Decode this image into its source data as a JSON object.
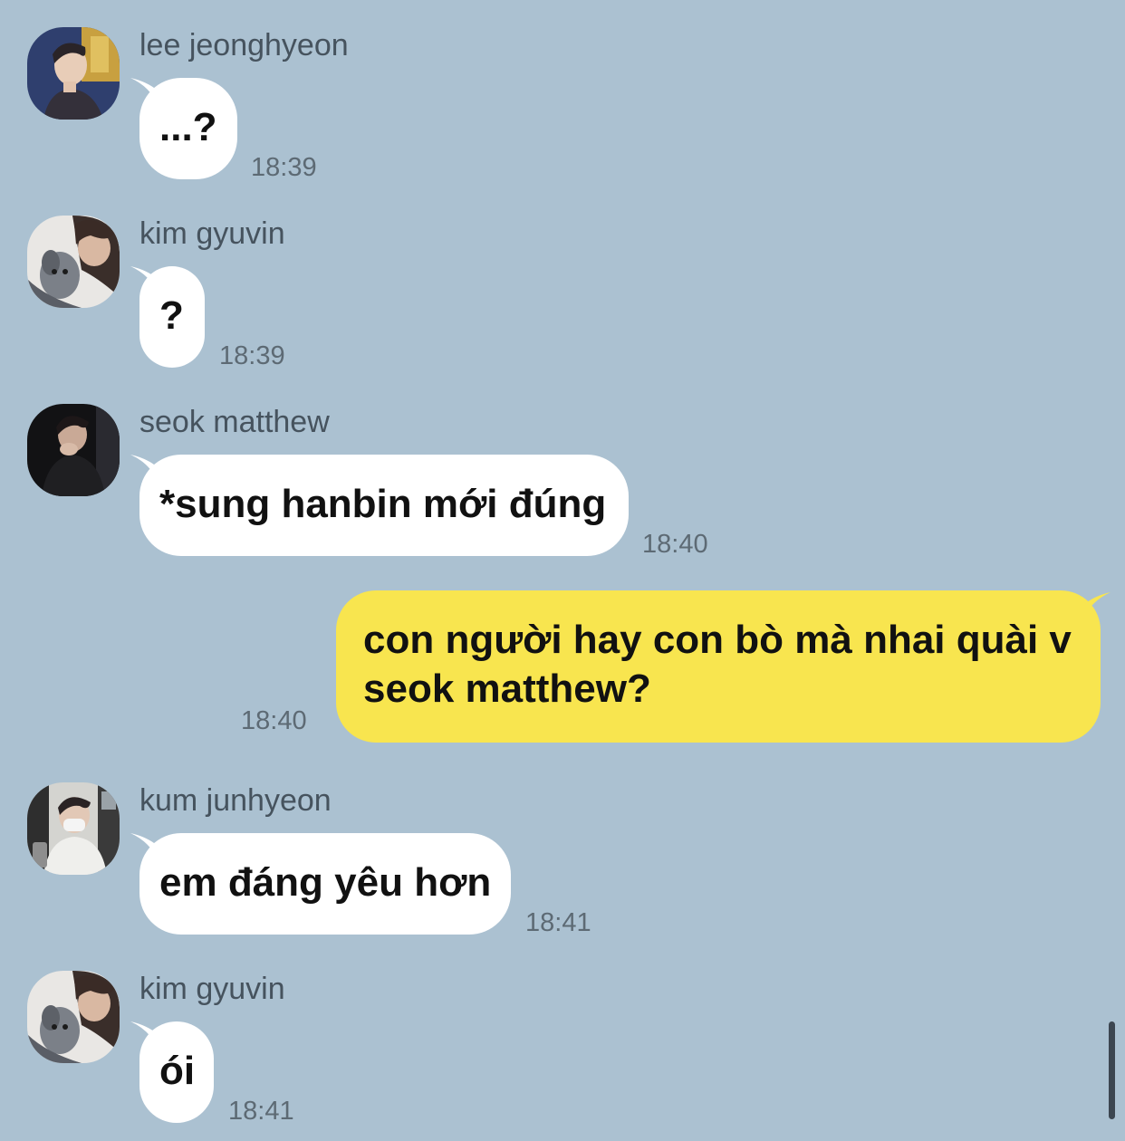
{
  "messages": [
    {
      "sender": "lee jeonghyeon",
      "text": "...?",
      "time": "18:39",
      "avatar": "profile-photo-lee-jeonghyeon"
    },
    {
      "sender": "kim gyuvin",
      "text": "?",
      "time": "18:39",
      "avatar": "profile-photo-kim-gyuvin"
    },
    {
      "sender": "seok matthew",
      "text": "*sung hanbin mới đúng",
      "time": "18:40",
      "avatar": "profile-photo-seok-matthew"
    },
    {
      "sender": "",
      "text": "con người hay con bò mà nhai quài v seok matthew?",
      "time": "18:40",
      "outgoing": true
    },
    {
      "sender": "kum junhyeon",
      "text": "em đáng yêu hơn",
      "time": "18:41",
      "avatar": "profile-photo-kum-junhyeon"
    },
    {
      "sender": "kim gyuvin",
      "text": "ói",
      "time": "18:41",
      "avatar": "profile-photo-kim-gyuvin"
    }
  ],
  "colors": {
    "background": "#abc1d1",
    "incoming_bubble": "#ffffff",
    "outgoing_bubble": "#f8e54f",
    "sender_text": "#46535e",
    "time_text": "#5d6a74"
  }
}
